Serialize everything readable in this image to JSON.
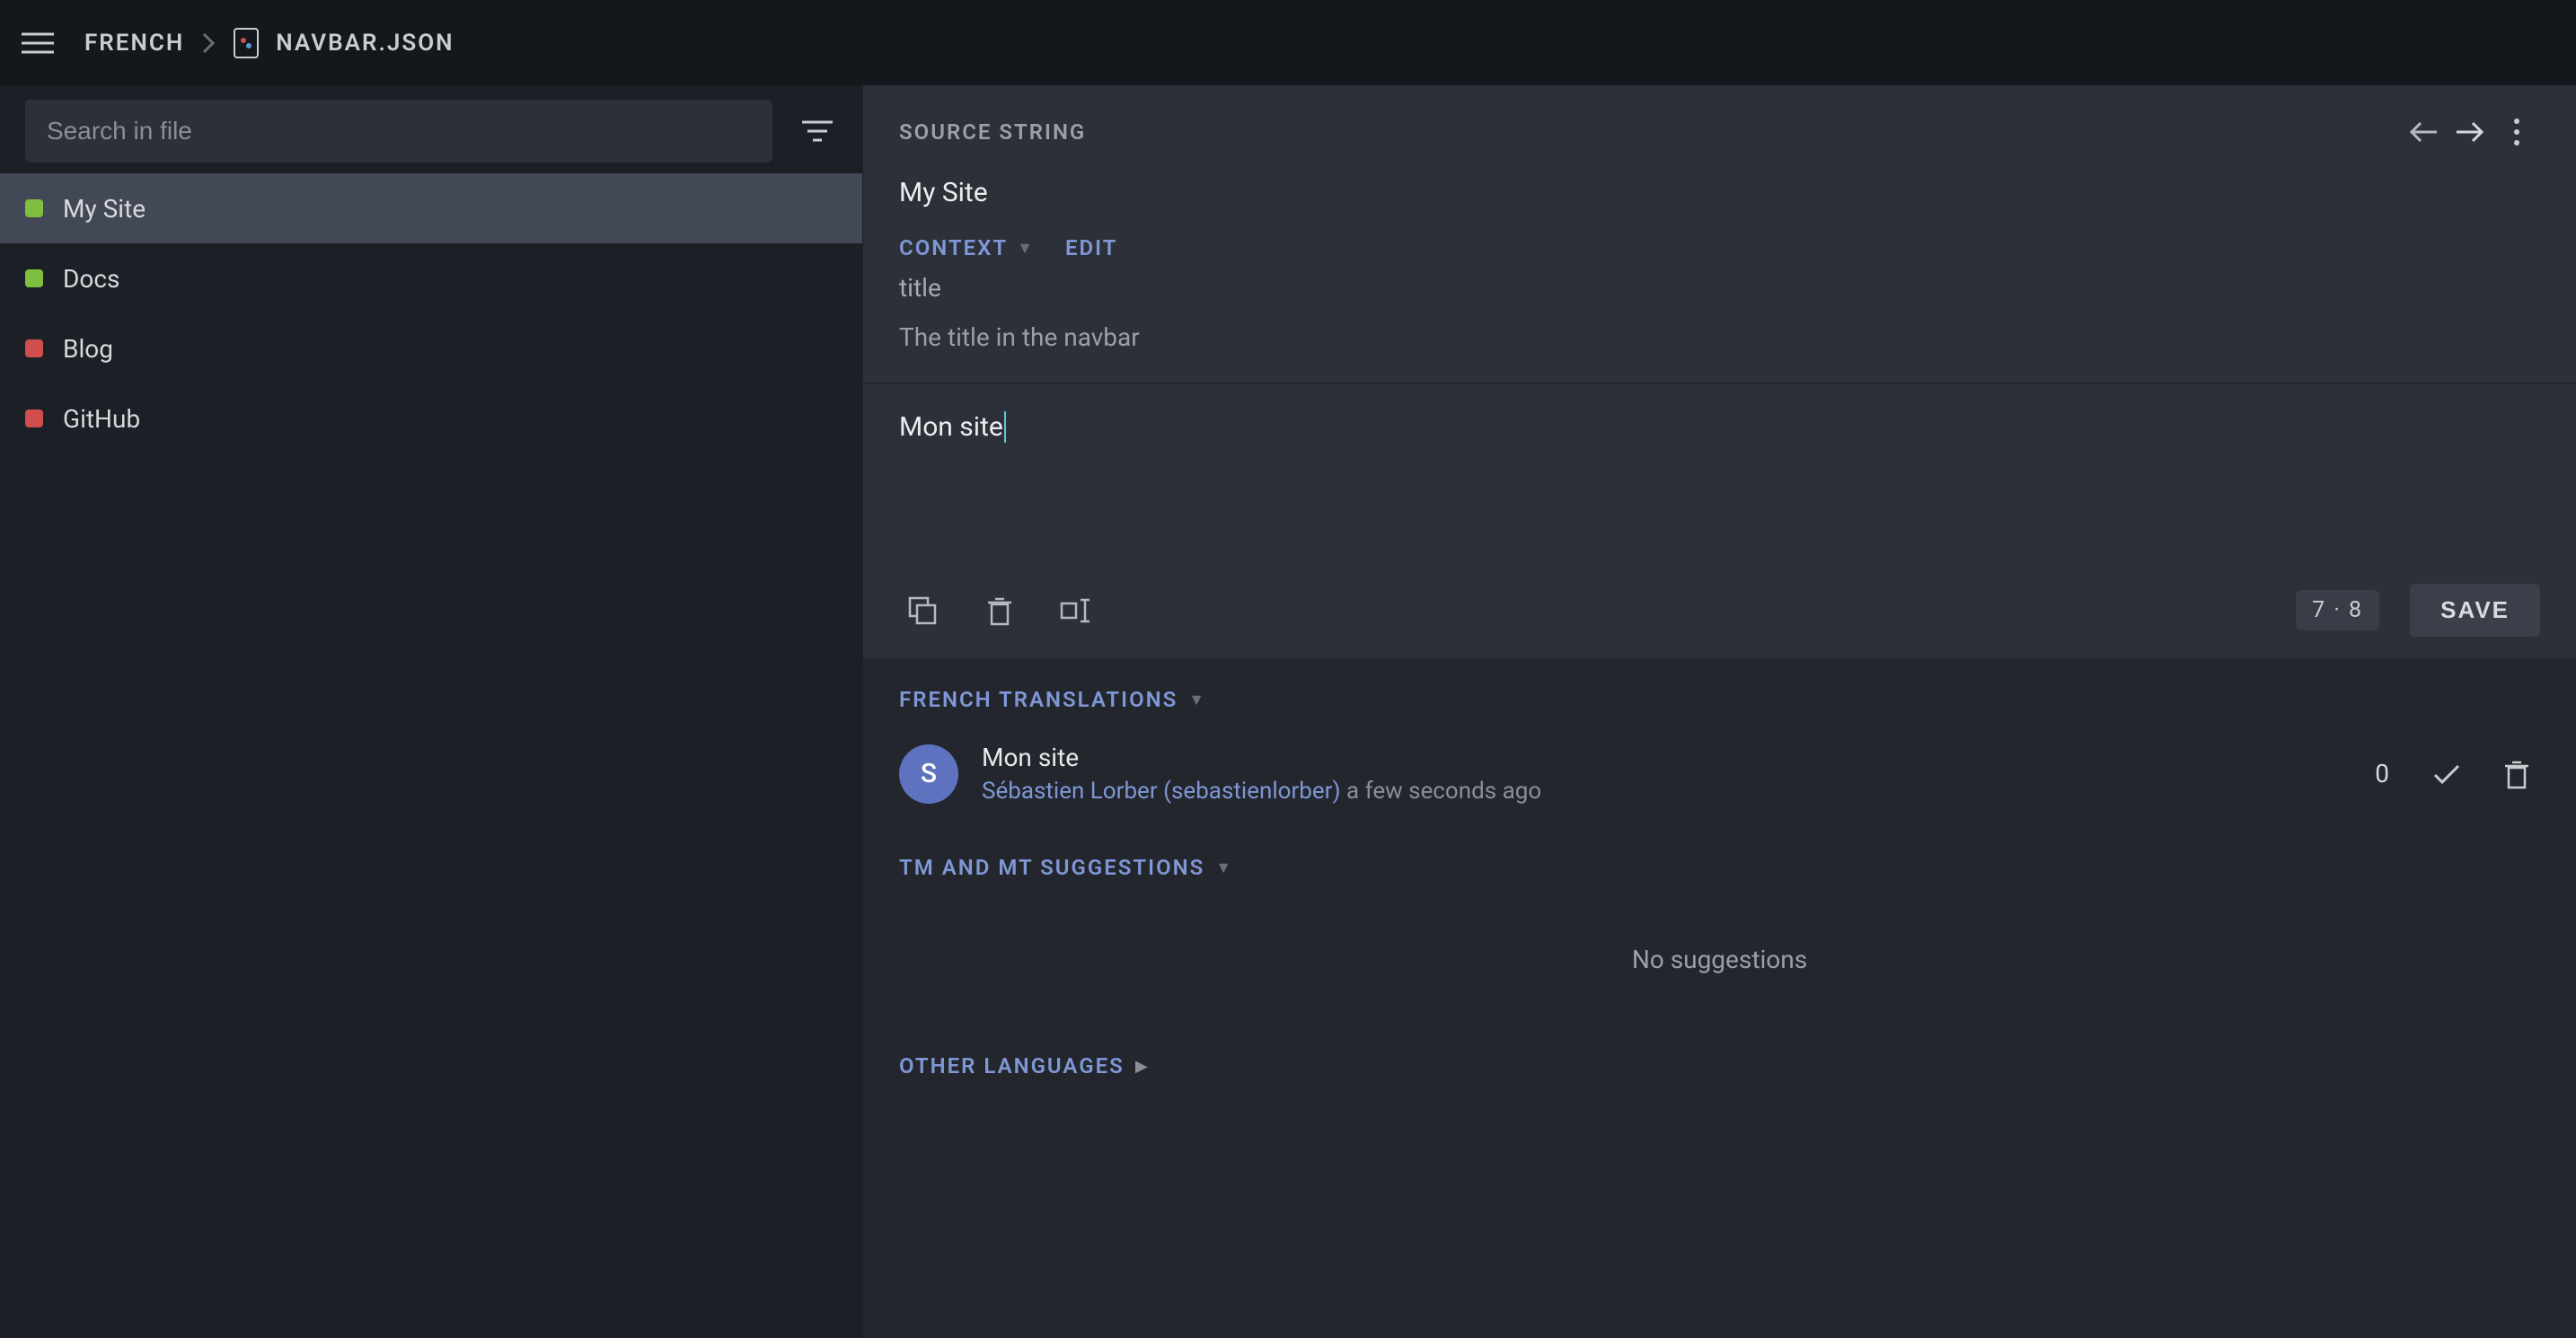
{
  "topbar": {
    "breadcrumb_lang": "FRENCH",
    "breadcrumb_file": "NAVBAR.JSON"
  },
  "sidebar": {
    "search_placeholder": "Search in file",
    "items": [
      {
        "label": "My Site",
        "status": "green",
        "active": true
      },
      {
        "label": "Docs",
        "status": "green",
        "active": false
      },
      {
        "label": "Blog",
        "status": "red",
        "active": false
      },
      {
        "label": "GitHub",
        "status": "red",
        "active": false
      }
    ]
  },
  "source": {
    "section_label": "SOURCE STRING",
    "text": "My Site",
    "context_label": "CONTEXT",
    "edit_label": "EDIT",
    "context_key": "title",
    "context_desc": "The title in the navbar"
  },
  "editor": {
    "value": "Mon site",
    "char_count": "7 · 8",
    "save_label": "SAVE"
  },
  "translations": {
    "header": "FRENCH TRANSLATIONS",
    "entry": {
      "avatar_initial": "S",
      "text": "Mon site",
      "user": "Sébastien Lorber (sebastienlorber)",
      "time": "a few seconds ago",
      "votes": "0"
    }
  },
  "suggestions": {
    "header": "TM AND MT SUGGESTIONS",
    "empty": "No suggestions"
  },
  "other": {
    "header": "OTHER LANGUAGES"
  }
}
